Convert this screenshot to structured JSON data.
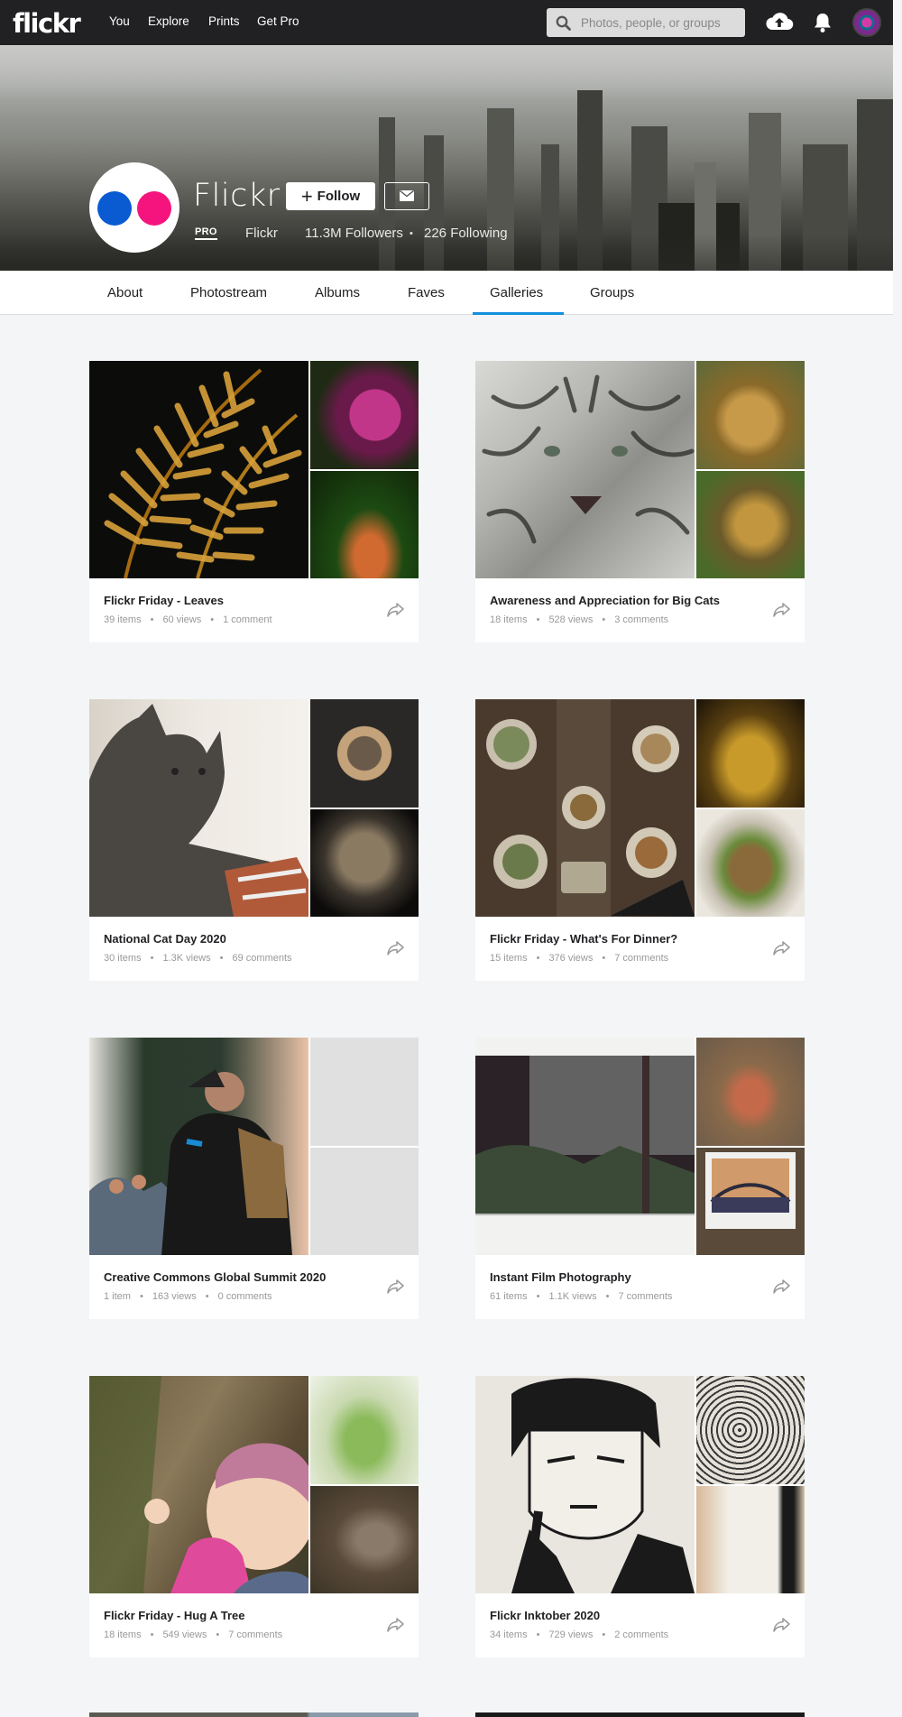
{
  "nav": {
    "logo": "flickr",
    "links": [
      "You",
      "Explore",
      "Prints",
      "Get Pro"
    ],
    "search_placeholder": "Photos, people, or groups",
    "icons": [
      "upload-cloud-icon",
      "bell-icon",
      "avatar"
    ]
  },
  "profile": {
    "name": "Flickr",
    "follow_label": "Follow",
    "pro_badge": "PRO",
    "username": "Flickr",
    "followers": "11.3M Followers",
    "following": "226 Following",
    "separator": "•"
  },
  "tabs": {
    "items": [
      "About",
      "Photostream",
      "Albums",
      "Faves",
      "Galleries",
      "Groups"
    ],
    "active": "Galleries",
    "accent": "#128fdc"
  },
  "galleries": [
    {
      "title": "Flickr Friday - Leaves",
      "items": "39 items",
      "views": "60 views",
      "comments": "1 comment"
    },
    {
      "title": "Awareness and Appreciation for Big Cats",
      "items": "18 items",
      "views": "528 views",
      "comments": "3 comments"
    },
    {
      "title": "National Cat Day 2020",
      "items": "30 items",
      "views": "1.3K views",
      "comments": "69 comments"
    },
    {
      "title": "Flickr Friday - What's For Dinner?",
      "items": "15 items",
      "views": "376 views",
      "comments": "7 comments"
    },
    {
      "title": "Creative Commons Global Summit 2020",
      "items": "1 item",
      "views": "163 views",
      "comments": "0 comments"
    },
    {
      "title": "Instant Film Photography",
      "items": "61 items",
      "views": "1.1K views",
      "comments": "7 comments"
    },
    {
      "title": "Flickr Friday - Hug A Tree",
      "items": "18 items",
      "views": "549 views",
      "comments": "7 comments"
    },
    {
      "title": "Flickr Inktober 2020",
      "items": "34 items",
      "views": "729 views",
      "comments": "2 comments"
    }
  ],
  "meta_separator": "•"
}
